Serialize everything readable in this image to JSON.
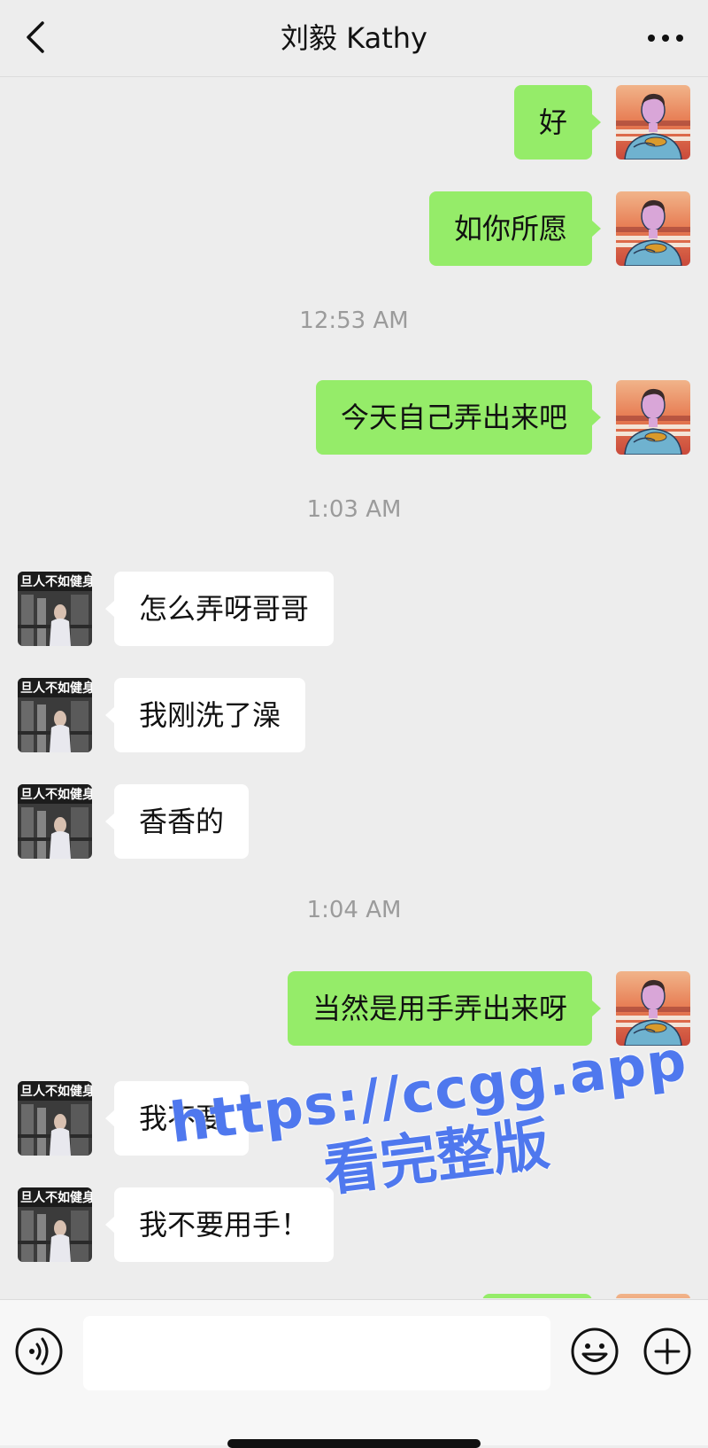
{
  "header": {
    "title": "刘毅 Kathy",
    "back_icon": "chevron-left-icon",
    "more_icon": "more-dots-icon"
  },
  "messages": [
    {
      "side": "right",
      "text": "好"
    },
    {
      "side": "right",
      "text": "如你所愿"
    },
    {
      "timestamp": "12:53 AM"
    },
    {
      "side": "right",
      "text": "今天自己弄出来吧"
    },
    {
      "timestamp": "1:03 AM"
    },
    {
      "side": "left",
      "text": "怎么弄呀哥哥"
    },
    {
      "side": "left",
      "text": "我刚洗了澡"
    },
    {
      "side": "left",
      "text": "香香的"
    },
    {
      "timestamp": "1:04 AM"
    },
    {
      "side": "right",
      "text": "当然是用手弄出来呀"
    },
    {
      "side": "left",
      "text": "我不要"
    },
    {
      "side": "left",
      "text": "我不要用手！"
    },
    {
      "side": "right",
      "text": ""
    }
  ],
  "watermark": {
    "line1": "https://ccgg.app",
    "line2": "看完整版",
    "color": "#4f78ee"
  },
  "input_bar": {
    "voice_icon": "voice-icon",
    "emoji_icon": "emoji-icon",
    "plus_icon": "plus-icon",
    "input_value": ""
  },
  "colors": {
    "sent_bubble": "#95ec69",
    "received_bubble": "#ffffff",
    "background": "#ededed"
  }
}
